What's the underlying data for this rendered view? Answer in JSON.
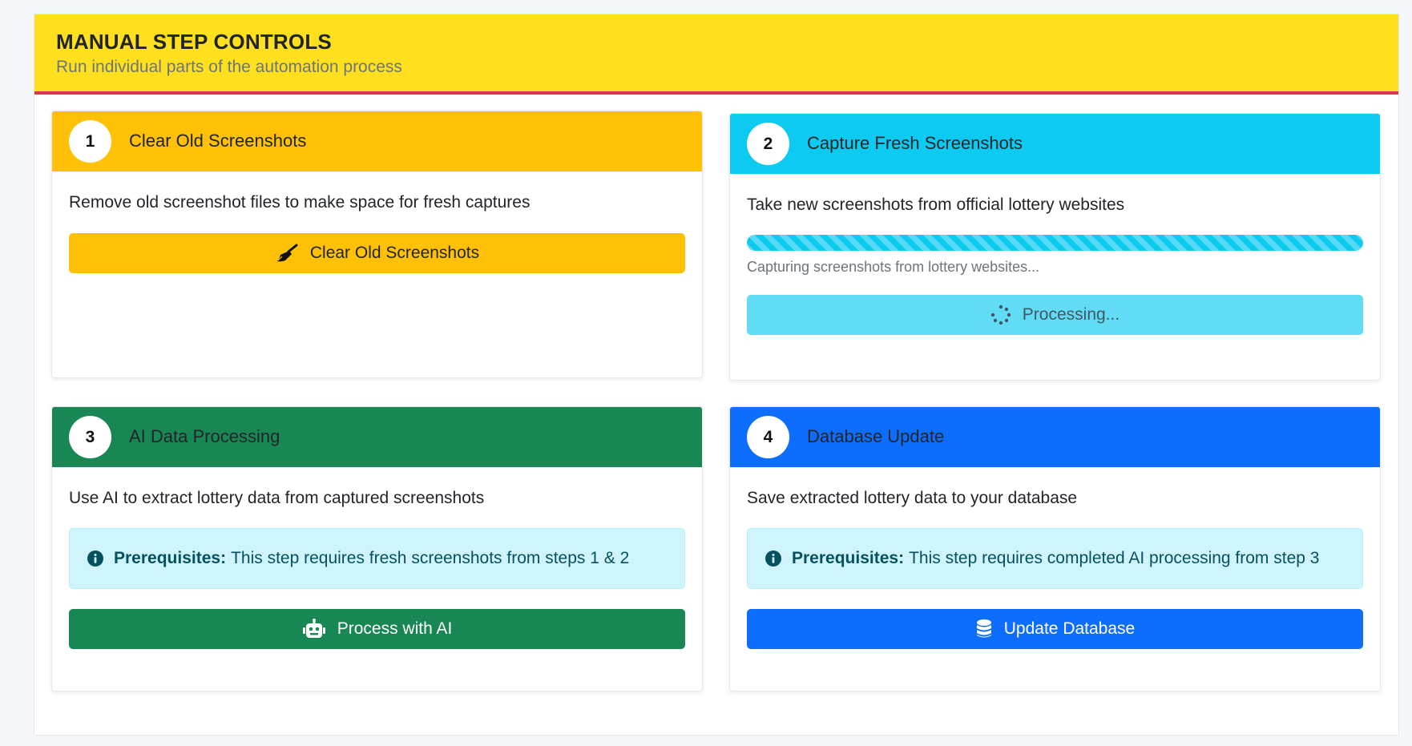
{
  "panel": {
    "title": "MANUAL STEP CONTROLS",
    "subtitle": "Run individual parts of the automation process"
  },
  "cards": [
    {
      "number": "1",
      "title": "Clear Old Screenshots",
      "description": "Remove old screenshot files to make space for fresh captures",
      "button_label": "Clear Old Screenshots",
      "button_icon": "broom-icon",
      "color": "#ffc107"
    },
    {
      "number": "2",
      "title": "Capture Fresh Screenshots",
      "description": "Take new screenshots from official lottery websites",
      "progress_percent": 100,
      "progress_text": "Capturing screenshots from lottery websites...",
      "button_label": "Processing...",
      "button_icon": "spinner-icon",
      "button_state": "disabled",
      "color": "#0dcaf0"
    },
    {
      "number": "3",
      "title": "AI Data Processing",
      "description": "Use AI to extract lottery data from captured screenshots",
      "prereq_label": "Prerequisites:",
      "prereq_text": "This step requires fresh screenshots from steps 1 & 2",
      "button_label": "Process with AI",
      "button_icon": "robot-icon",
      "color": "#198754"
    },
    {
      "number": "4",
      "title": "Database Update",
      "description": "Save extracted lottery data to your database",
      "prereq_label": "Prerequisites:",
      "prereq_text": "This step requires completed AI processing from step 3",
      "button_label": "Update Database",
      "button_icon": "database-icon",
      "color": "#0d6efd"
    }
  ]
}
